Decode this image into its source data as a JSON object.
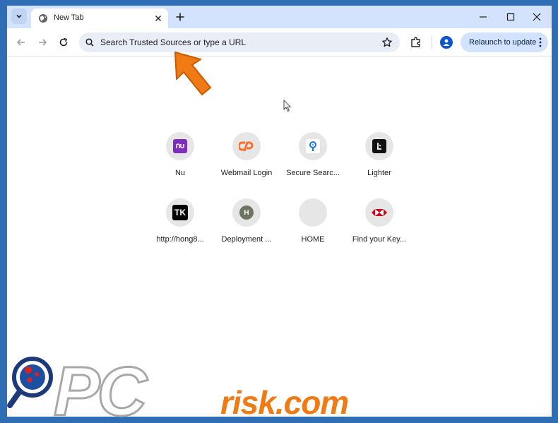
{
  "tab": {
    "title": "New Tab"
  },
  "omnibox": {
    "placeholder": "Search Trusted Sources or type a URL"
  },
  "toolbar": {
    "relaunch_label": "Relaunch to update"
  },
  "shortcuts": [
    {
      "label": "Nu",
      "icon": "nu-logo-icon",
      "color": "#7b2fbf"
    },
    {
      "label": "Webmail Login",
      "icon": "cpanel-logo-icon",
      "color": "#ff6c2c"
    },
    {
      "label": "Secure Searc...",
      "icon": "secure-search-icon",
      "color": "#1a73e8"
    },
    {
      "label": "Lighter",
      "icon": "lighter-logo-icon",
      "color": "#111111"
    },
    {
      "label": "http://hong8...",
      "icon": "tiktok-tk-icon",
      "color": "#000000",
      "glyph": "TK"
    },
    {
      "label": "Deployment ...",
      "icon": "letter-h-icon",
      "color": "#6b7560",
      "glyph": "H"
    },
    {
      "label": "HOME",
      "icon": "blank-favicon-icon",
      "color": "#e6e6e6"
    },
    {
      "label": "Find your Key...",
      "icon": "hsbc-logo-icon",
      "color": "#db0011"
    }
  ],
  "watermark": {
    "prefix": "PC",
    "text": "risk.com"
  },
  "colors": {
    "frame": "#2f6db5",
    "tabstrip": "#d3e3fd",
    "arrow": "#f07a14"
  }
}
